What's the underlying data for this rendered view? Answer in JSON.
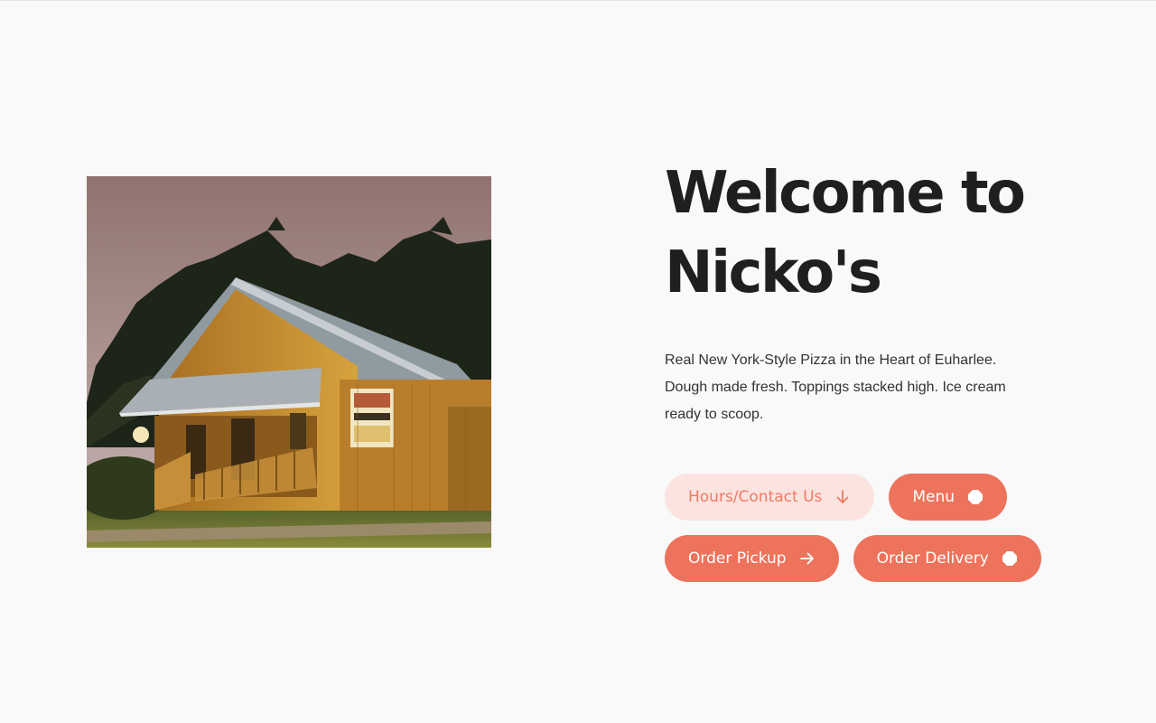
{
  "hero": {
    "title_line1": "Welcome to",
    "title_line2": "Nicko's",
    "intro": "Real New York-Style Pizza in the Heart of Euharlee. Dough made fresh. Toppings stacked high. Ice cream ready to scoop."
  },
  "actions": [
    {
      "label": "Hours/Contact Us",
      "icon": "arrow-down-icon",
      "style": "soft"
    },
    {
      "label": "Menu",
      "icon": "circle-icon",
      "style": "solid"
    },
    {
      "label": "Order Pickup",
      "icon": "arrow-right-icon",
      "style": "solid"
    },
    {
      "label": "Order Delivery",
      "icon": "circle-icon",
      "style": "solid"
    }
  ],
  "colors": {
    "accent": "#ee735c",
    "accent_soft_bg": "#fbe3df",
    "title": "#1f1f1f",
    "body_text": "#333333",
    "background": "#f9f9f9"
  }
}
